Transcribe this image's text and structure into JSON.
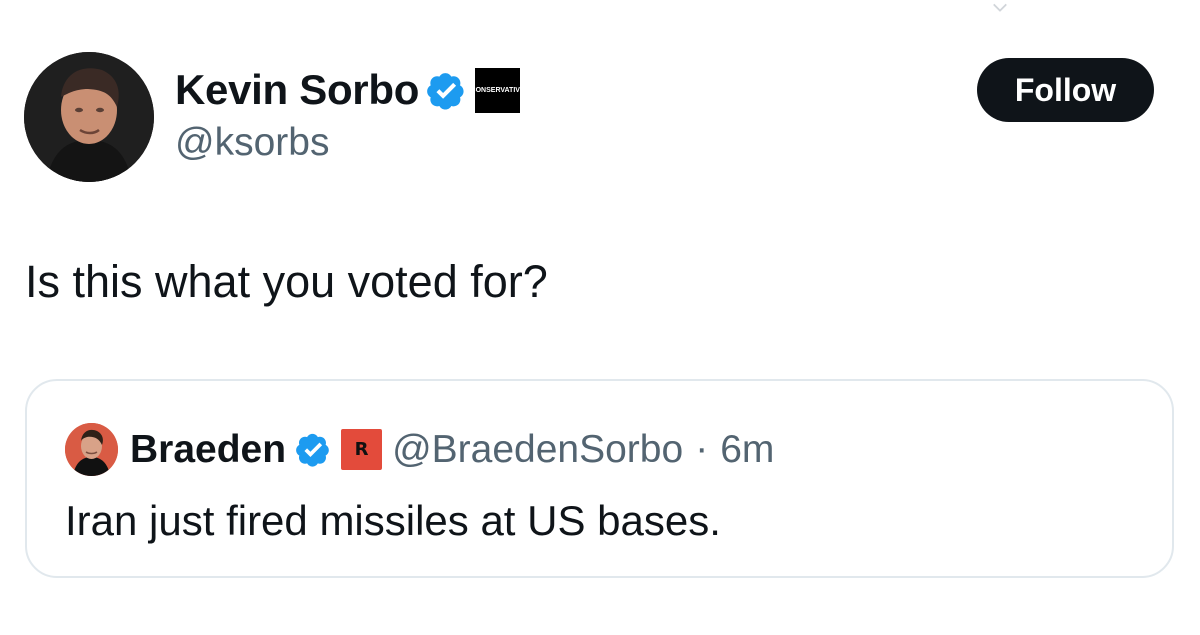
{
  "tweet": {
    "author": {
      "name": "Kevin Sorbo",
      "handle": "@ksorbs",
      "verified_icon": "verified-badge-icon",
      "affiliation_label": "CONSERVATIVE"
    },
    "follow_label": "Follow",
    "text": "Is this what you voted for?"
  },
  "quote": {
    "author": {
      "name": "Braeden",
      "handle": "@BraedenSorbo",
      "separator": "·",
      "time": "6m",
      "verified_icon": "verified-badge-icon",
      "affiliation_label": "R"
    },
    "text": "Iran just fired missiles at US bases."
  },
  "colors": {
    "text_primary": "#0f1419",
    "text_secondary": "#536471",
    "verified_blue": "#1d9bf0",
    "border": "#e1e8ed",
    "button_black": "#0f1419",
    "affiliation_red": "#e34b3b"
  }
}
